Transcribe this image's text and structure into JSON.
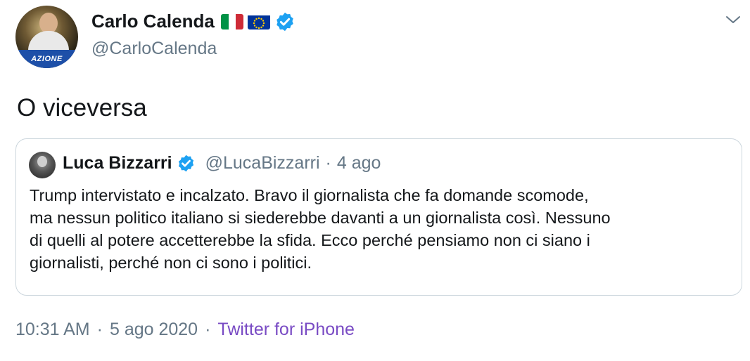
{
  "author": {
    "name": "Carlo Calenda",
    "handle": "@CarloCalenda",
    "avatar_brand": "AZIONE"
  },
  "tweet": {
    "text": "O viceversa"
  },
  "quoted_tweet": {
    "name": "Luca Bizzarri",
    "handle": "@LucaBizzarri",
    "separator": "·",
    "time": "4 ago",
    "lines": [
      "Trump intervistato e incalzato. Bravo il giornalista che fa domande scomode,",
      "ma nessun politico italiano si siederebbe davanti a un giornalista così. Nessuno",
      "di quelli al potere accetterebbe la sfida. Ecco perché pensiamo non ci siano i",
      "giornalisti, perché non ci sono i politici."
    ]
  },
  "meta": {
    "time": "10:31 AM",
    "separator": "·",
    "date": "5 ago 2020",
    "source": "Twitter for iPhone"
  },
  "icons": {
    "verified": "verified-badge-icon",
    "caret": "chevron-down-icon",
    "flag_it": "italy-flag-icon",
    "flag_eu": "eu-flag-icon"
  },
  "colors": {
    "verified": "#1da1f2",
    "secondary_text": "#657786",
    "source_link": "#794bc4",
    "border": "#ccd6dd"
  }
}
